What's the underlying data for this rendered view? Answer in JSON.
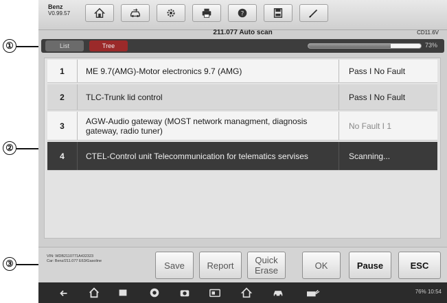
{
  "callouts": [
    "①",
    "②",
    "③"
  ],
  "toolbar": {
    "brand": "Benz",
    "version": "V0.99.57",
    "buttons": [
      "home-icon",
      "vehicle-swap-icon",
      "settings-icon",
      "print-icon",
      "help-icon",
      "save-icon",
      "pen-icon"
    ]
  },
  "header": {
    "title": "211.077 Auto scan",
    "voltage": "CD11.6V"
  },
  "tabs": [
    {
      "label": "List"
    },
    {
      "label": "Tree"
    }
  ],
  "progress": {
    "percent": 73,
    "label": "73%"
  },
  "results": [
    {
      "num": "1",
      "desc": "ME 9.7(AMG)-Motor electronics 9.7 (AMG)",
      "status": "Pass I No Fault"
    },
    {
      "num": "2",
      "desc": "TLC-Trunk lid control",
      "status": "Pass I No Fault"
    },
    {
      "num": "3",
      "desc": "AGW-Audio gateway (MOST network managment, diagnosis gateway, radio tuner)",
      "status": "No Fault I 1"
    },
    {
      "num": "4",
      "desc": "CTEL-Control unit Telecommunication for telematics servises",
      "status": "Scanning..."
    }
  ],
  "vehicle": {
    "vin": "VIN: WDB2110771A432323",
    "car": "Car: Benz/211.077 E63/Gasoline"
  },
  "functions": {
    "save": "Save",
    "report": "Report",
    "quick_erase": "Quick Erase",
    "ok": "OK",
    "pause": "Pause",
    "esc": "ESC"
  },
  "system": {
    "status": "76% 10:54"
  }
}
